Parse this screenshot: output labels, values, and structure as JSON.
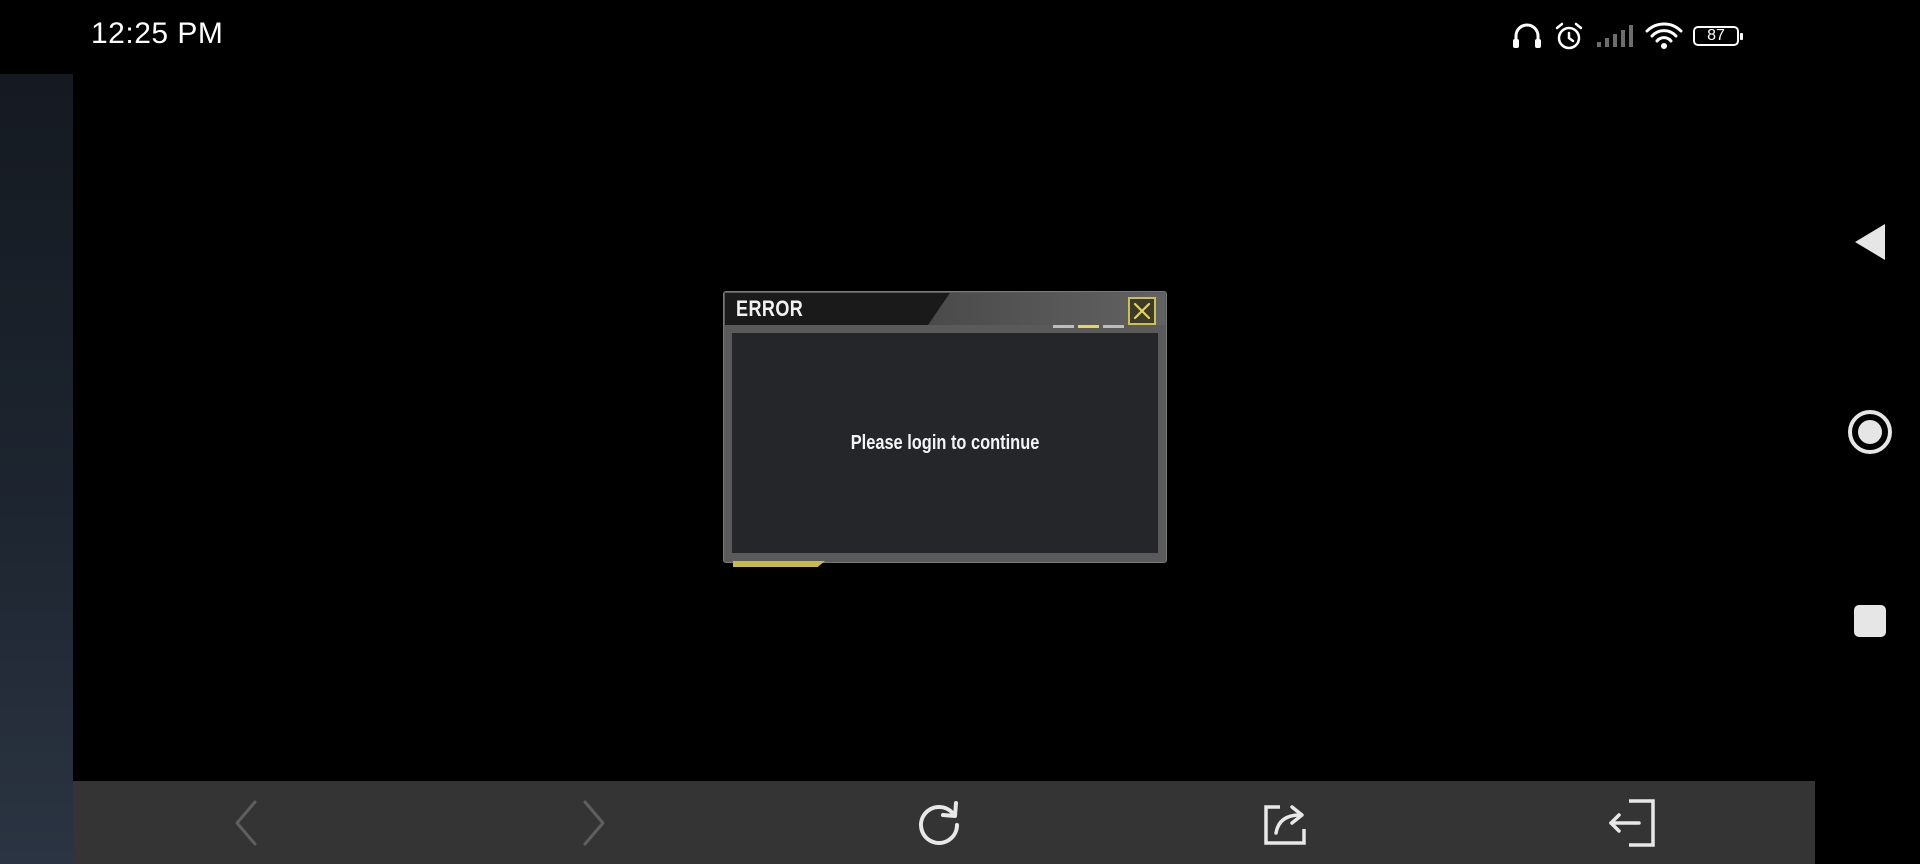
{
  "status_bar": {
    "time": "12:25 PM",
    "icons": [
      "headphones-icon",
      "alarm-icon",
      "signal-icon",
      "wifi-icon",
      "battery-icon"
    ],
    "battery_level": "87"
  },
  "dialog": {
    "title": "ERROR",
    "message": "Please login to continue",
    "close_icon": "close-icon",
    "accent_color": "#e6d65a"
  },
  "bottom_bar": {
    "buttons": [
      "back-icon",
      "forward-icon",
      "refresh-icon",
      "share-icon",
      "exit-icon"
    ]
  },
  "nav_buttons": [
    "nav-back-icon",
    "nav-home-icon",
    "nav-recents-icon"
  ]
}
